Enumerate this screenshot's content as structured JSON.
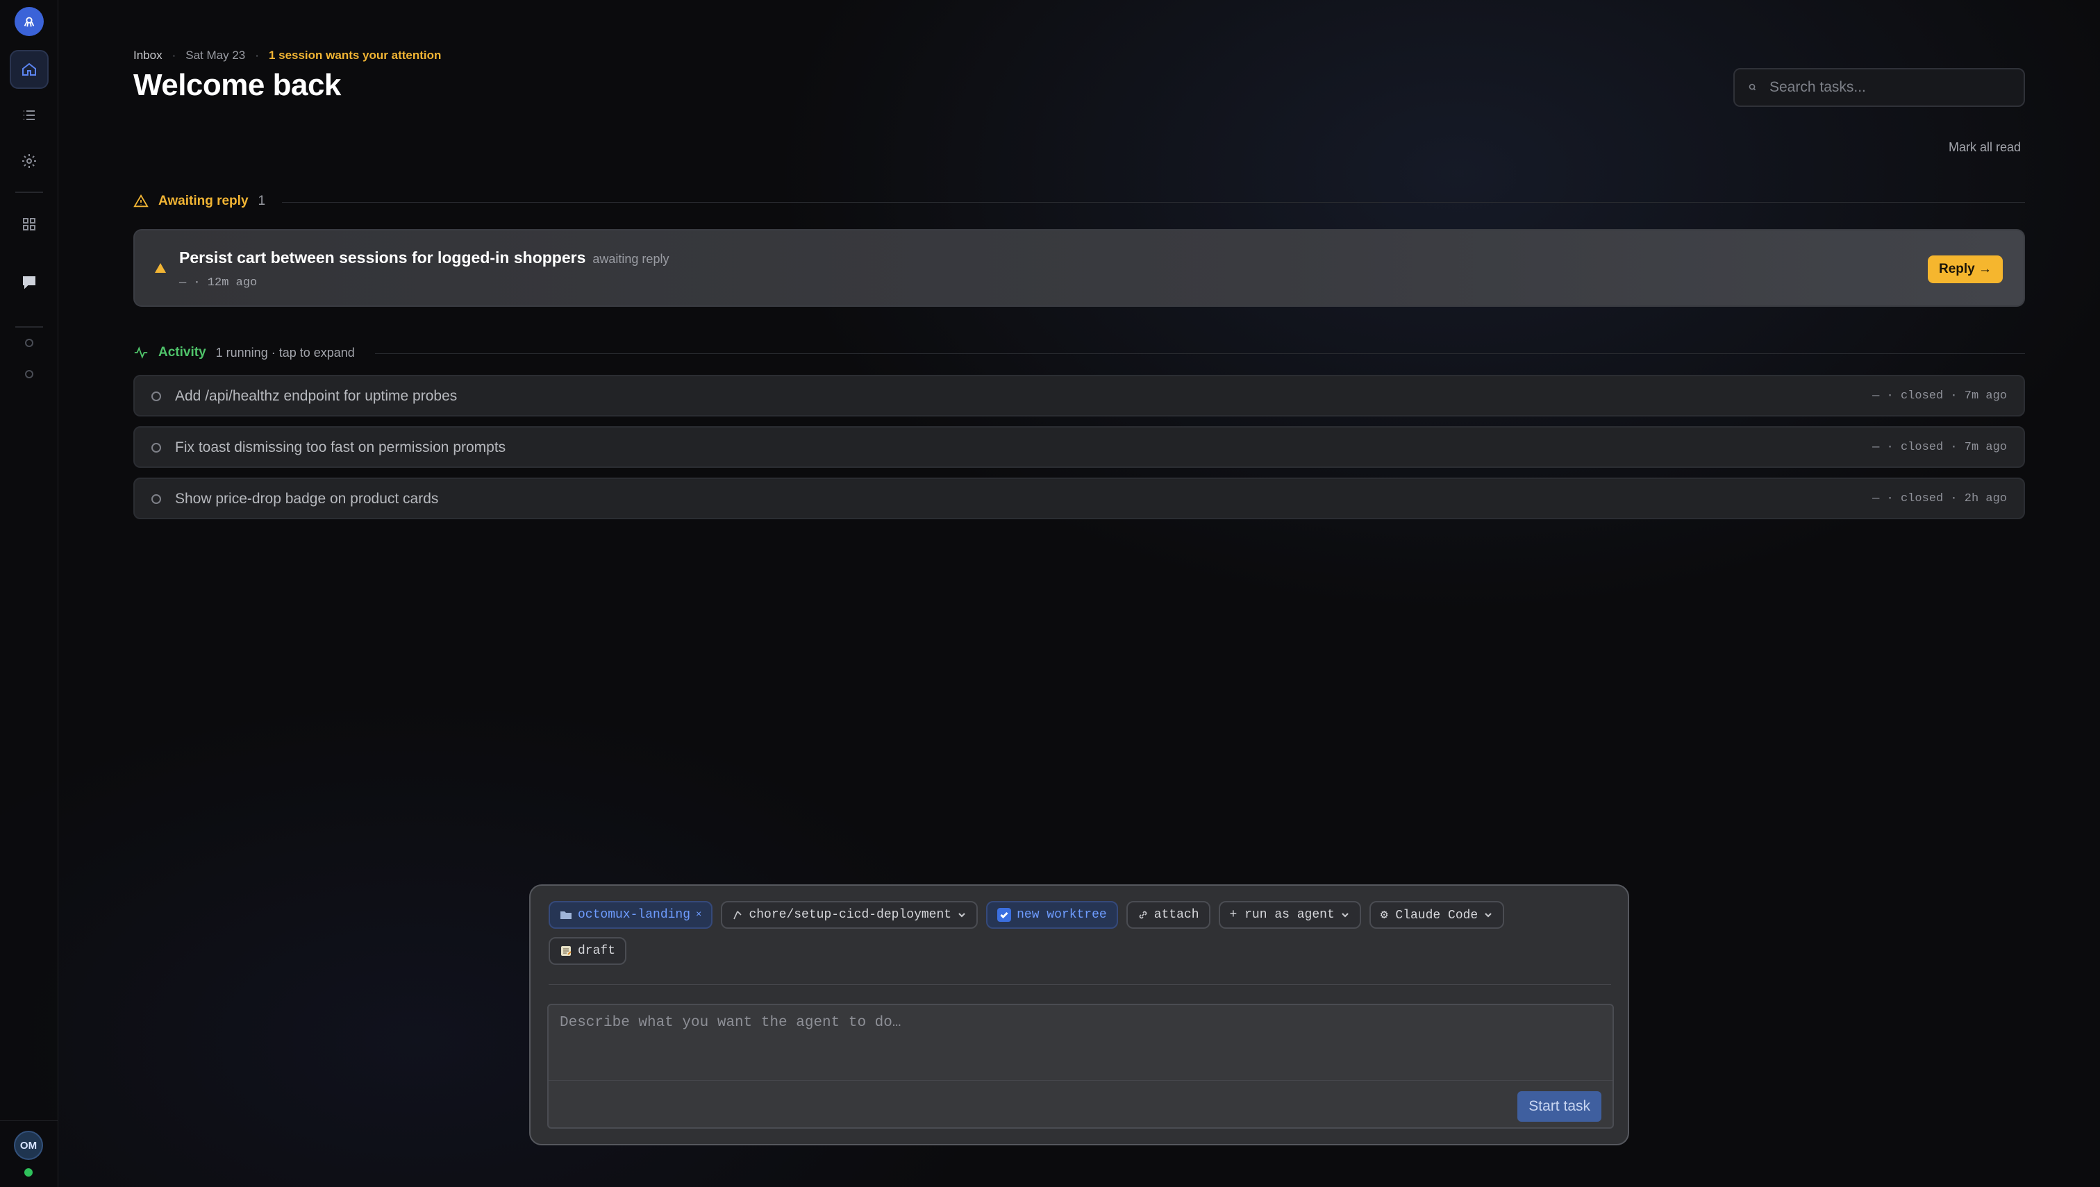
{
  "sidebar": {
    "logo_icon": "logo-icon",
    "items": [
      {
        "name": "home",
        "icon": "home-icon",
        "active": true
      },
      {
        "name": "tasks",
        "icon": "list-icon",
        "active": false
      },
      {
        "name": "settings",
        "icon": "gear-icon",
        "active": false
      },
      {
        "name": "apps",
        "icon": "grid-icon",
        "active": false
      },
      {
        "name": "chat",
        "icon": "chat-bubble-icon",
        "active": false
      }
    ],
    "user_initials": "OM",
    "status_color": "#2fc25b"
  },
  "header": {
    "breadcrumb": "Inbox",
    "date": "Sat May 23",
    "attention": "1 session wants your attention",
    "title": "Welcome back",
    "search_placeholder": "Search tasks...",
    "mark_all_read": "Mark all read"
  },
  "awaiting": {
    "label": "Awaiting reply",
    "count": "1",
    "items": [
      {
        "title": "Persist cart between sessions for logged-in shoppers",
        "status": "awaiting reply",
        "meta": "— · 12m ago",
        "reply_label": "Reply →"
      }
    ]
  },
  "activity": {
    "label": "Activity",
    "subtitle": "1 running · tap to expand",
    "items": [
      {
        "title": "Add /api/healthz endpoint for uptime probes",
        "meta": "— · closed · 7m ago"
      },
      {
        "title": "Fix toast dismissing too fast on permission prompts",
        "meta": "— · closed · 7m ago"
      },
      {
        "title": "Show price-drop badge on product cards",
        "meta": "— · closed · 2h ago"
      }
    ]
  },
  "composer": {
    "repo": "octomux-landing",
    "branch": "chore/setup-cicd-deployment",
    "worktree": "new worktree",
    "attach": "attach",
    "run_as": "+ run as agent",
    "agent": "⚙ Claude Code",
    "draft": "draft",
    "prompt_placeholder": "Describe what you want the agent to do…",
    "start_label": "Start task"
  },
  "colors": {
    "accent": "#3b63d8",
    "warning": "#f2b534",
    "success": "#4fc36a"
  }
}
